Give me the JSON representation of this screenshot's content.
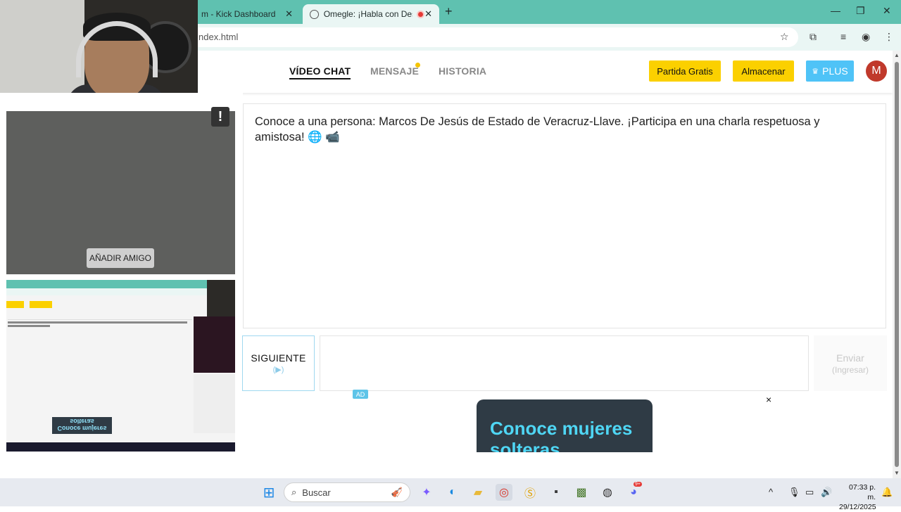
{
  "browser": {
    "tabs": [
      {
        "title": "m - Kick Dashboard",
        "active": false
      },
      {
        "title": "Omegle: ¡Habla con Desco",
        "active": true
      }
    ],
    "address": "ndex.html",
    "new_tab_icon": "plus-icon"
  },
  "nav": {
    "links": [
      "VÍDEO CHAT",
      "MENSAJE",
      "HISTORIA"
    ],
    "active": "VÍDEO CHAT",
    "free_match": "Partida Gratis",
    "store": "Almacenar",
    "plus": "PLUS",
    "avatar_initial": "M",
    "colors": {
      "yellow": "#fbd000",
      "plus": "#4fc3f7",
      "avatar": "#c0392b"
    }
  },
  "video": {
    "report": "!",
    "add_friend": "AÑADIR AMIGO"
  },
  "chat": {
    "message": "Conoce a una persona: Marcos De Jesús de Estado de Veracruz-Llave. ¡Participa en una charla respetuosa y amistosa! 🌐 📹"
  },
  "controls": {
    "next_label": "SIGUIENTE",
    "next_hint": "(▶)",
    "message_value": "",
    "send_label": "Enviar",
    "send_hint": "(Ingresar)"
  },
  "ad": {
    "badge": "AD",
    "text": "Conoce mujeres solteras",
    "close": "×"
  },
  "taskbar": {
    "search_placeholder": "Buscar",
    "time": "07:33 p. m.",
    "date": "29/12/2025",
    "notification_count": "9+"
  },
  "mini_preview": {
    "ad_text": "Conoce mujeres solteras"
  }
}
